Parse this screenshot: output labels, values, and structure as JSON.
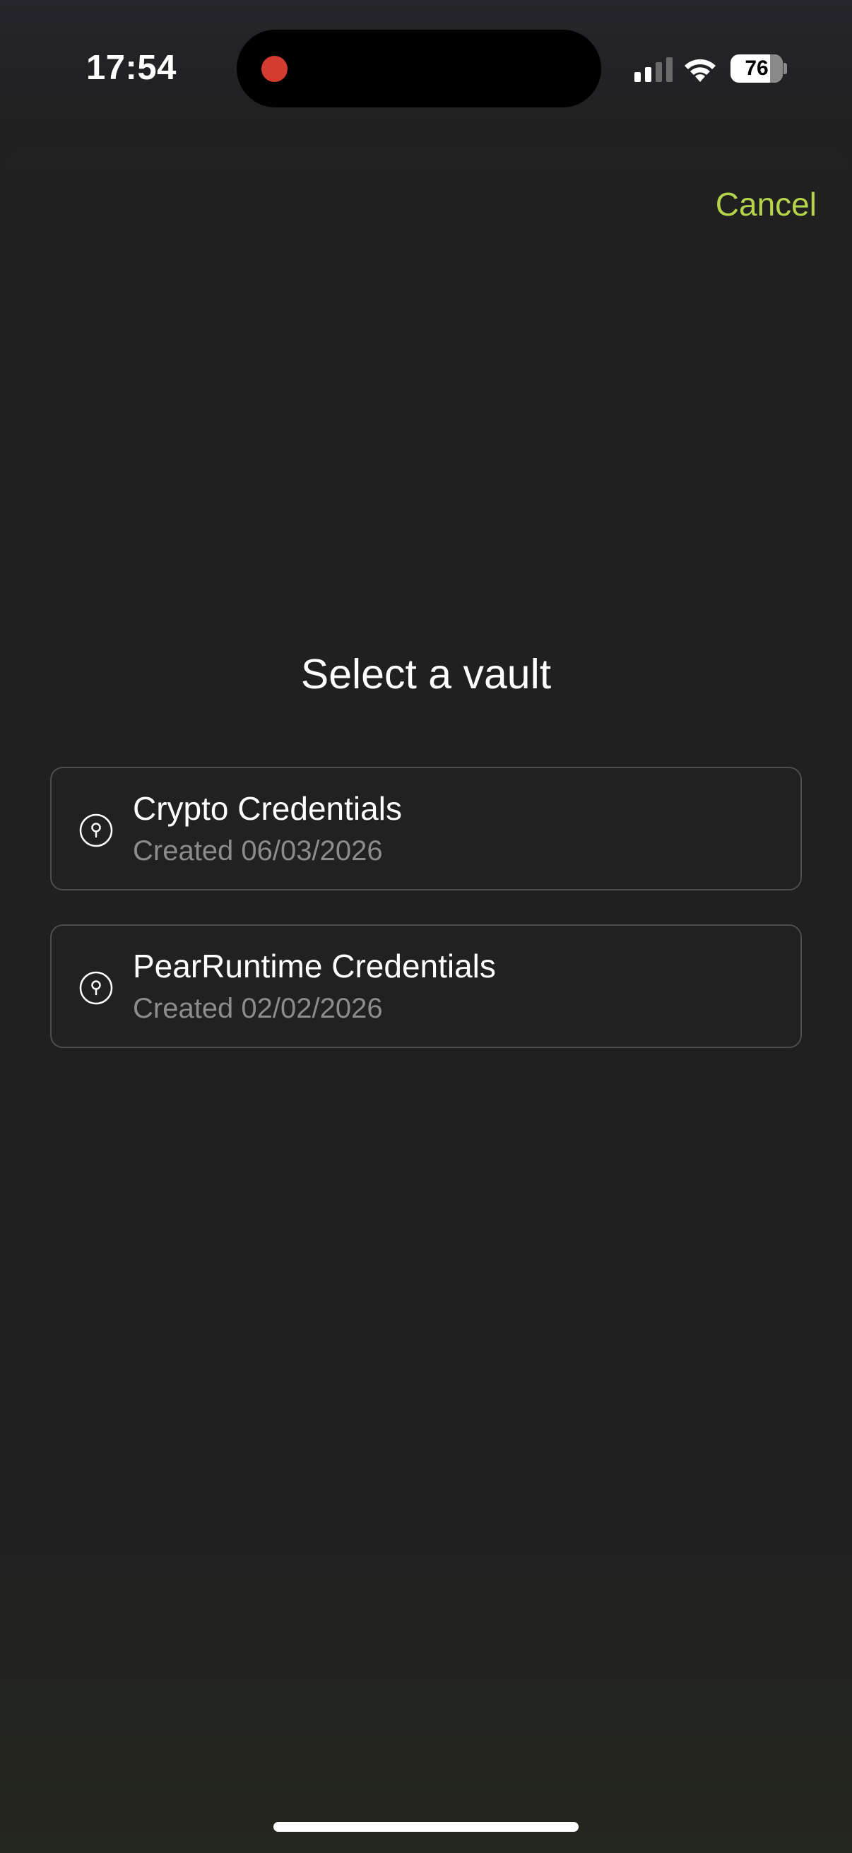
{
  "status_bar": {
    "time": "17:54",
    "battery_percent": "76",
    "battery_level": 0.76,
    "icons": [
      "signal-icon",
      "wifi-icon",
      "battery-icon"
    ],
    "recording_color": "#d43c2f"
  },
  "header": {
    "cancel_label": "Cancel",
    "accent_color": "#b3d44b"
  },
  "main": {
    "title": "Select a vault",
    "vaults": [
      {
        "name": "Crypto Credentials",
        "created": "Created 06/03/2026",
        "icon": "vault-lock-icon"
      },
      {
        "name": "PearRuntime Credentials",
        "created": "Created 02/02/2026",
        "icon": "vault-lock-icon"
      }
    ]
  }
}
